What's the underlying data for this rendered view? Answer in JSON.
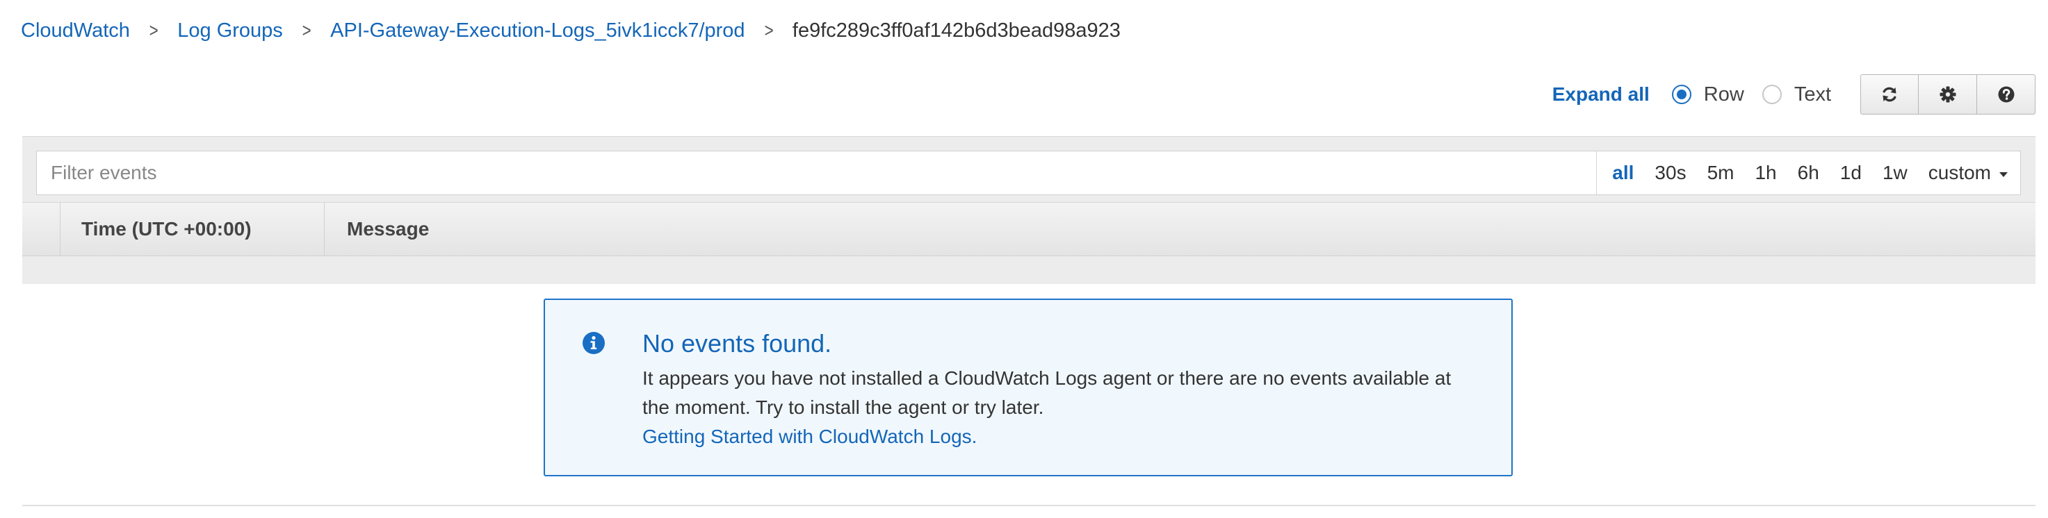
{
  "breadcrumb": {
    "items": [
      {
        "label": "CloudWatch"
      },
      {
        "label": "Log Groups"
      },
      {
        "label": "API-Gateway-Execution-Logs_5ivk1icck7/prod"
      }
    ],
    "separator": ">",
    "current": "fe9fc289c3ff0af142b6d3bead98a923"
  },
  "toolbar": {
    "expand_all": "Expand all",
    "view_mode": {
      "options": [
        {
          "label": "Row",
          "checked": true
        },
        {
          "label": "Text",
          "checked": false
        }
      ]
    },
    "buttons": [
      {
        "icon": "refresh-icon"
      },
      {
        "icon": "gear-icon"
      },
      {
        "icon": "help-icon"
      }
    ]
  },
  "filter": {
    "placeholder": "Filter events",
    "value": "",
    "ranges": [
      "all",
      "30s",
      "5m",
      "1h",
      "6h",
      "1d",
      "1w",
      "custom"
    ],
    "active_range": "all"
  },
  "table": {
    "columns": [
      "Time (UTC +00:00)",
      "Message"
    ],
    "rows": []
  },
  "empty_state": {
    "icon": "info-icon",
    "title": "No events found.",
    "text": "It appears you have not installed a CloudWatch Logs agent or there are no events available at the moment. Try to install the agent or try later.",
    "link": "Getting Started with CloudWatch Logs."
  },
  "colors": {
    "link": "#1466b8",
    "accent": "#1a6fc4",
    "info_background": "#f1f8fd",
    "panel_background": "#ececec"
  }
}
